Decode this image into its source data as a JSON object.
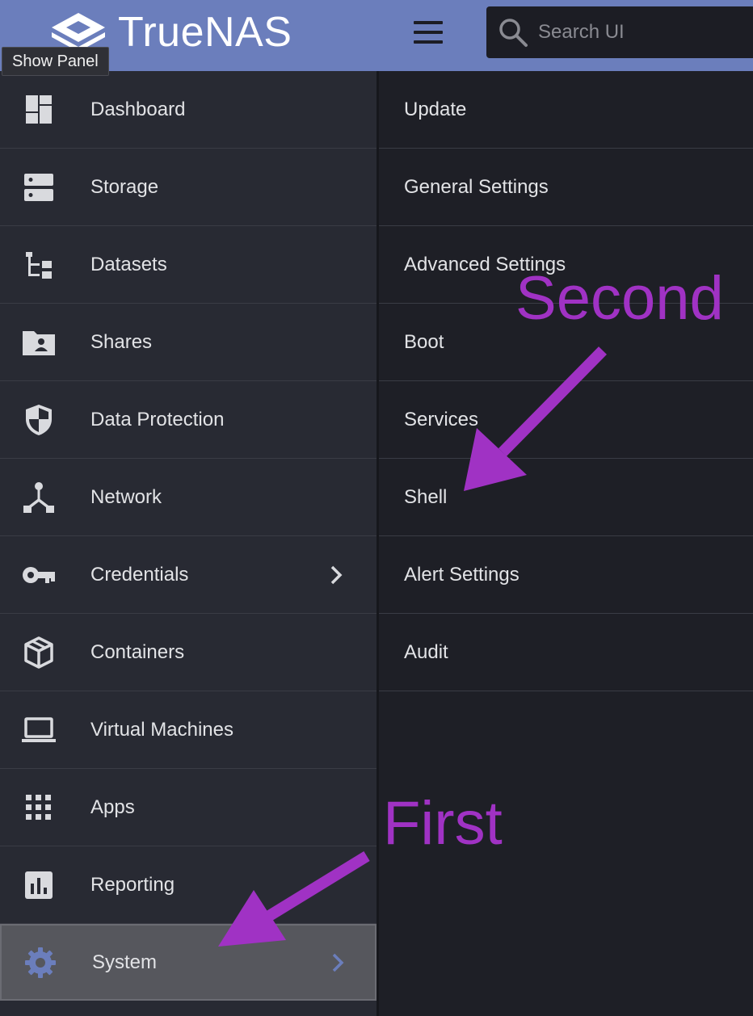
{
  "app": {
    "brand": "TrueNAS",
    "tooltip": "Show Panel"
  },
  "search": {
    "placeholder": "Search UI"
  },
  "sidebar": {
    "items": [
      {
        "label": "Dashboard",
        "icon": "dashboard-icon"
      },
      {
        "label": "Storage",
        "icon": "storage-icon"
      },
      {
        "label": "Datasets",
        "icon": "datasets-icon"
      },
      {
        "label": "Shares",
        "icon": "shares-folder-icon"
      },
      {
        "label": "Data Protection",
        "icon": "shield-icon"
      },
      {
        "label": "Network",
        "icon": "network-icon"
      },
      {
        "label": "Credentials",
        "icon": "key-icon",
        "has_submenu": true
      },
      {
        "label": "Containers",
        "icon": "cube-icon"
      },
      {
        "label": "Virtual Machines",
        "icon": "laptop-icon"
      },
      {
        "label": "Apps",
        "icon": "apps-grid-icon"
      },
      {
        "label": "Reporting",
        "icon": "bar-chart-icon"
      },
      {
        "label": "System",
        "icon": "gear-icon",
        "has_submenu": true,
        "active": true
      }
    ]
  },
  "submenu": {
    "items": [
      {
        "label": "Update"
      },
      {
        "label": "General Settings"
      },
      {
        "label": "Advanced Settings"
      },
      {
        "label": "Boot"
      },
      {
        "label": "Services"
      },
      {
        "label": "Shell"
      },
      {
        "label": "Alert Settings"
      },
      {
        "label": "Audit"
      }
    ]
  },
  "annotations": {
    "first": "First",
    "second": "Second"
  },
  "colors": {
    "topbar": "#6b7ebc",
    "sidebar": "#282a33",
    "submenu": "#1e1f26",
    "active_item": "#56575d",
    "annotation": "#a032c4",
    "icon": "#d9dade",
    "active_icon": "#6b7ebc"
  }
}
